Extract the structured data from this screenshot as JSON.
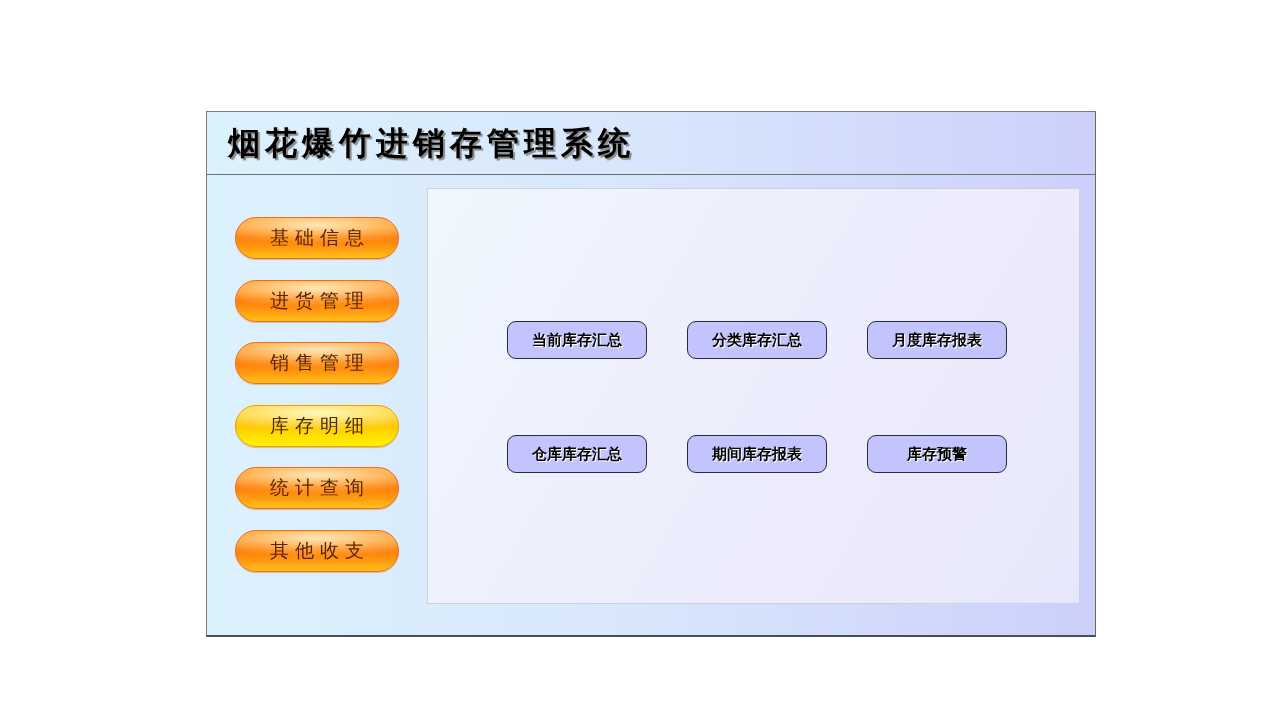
{
  "title": "烟花爆竹进销存管理系统",
  "sidebar": {
    "items": [
      {
        "label": "基础信息",
        "selected": false
      },
      {
        "label": "进货管理",
        "selected": false
      },
      {
        "label": "销售管理",
        "selected": false
      },
      {
        "label": "库存明细",
        "selected": true
      },
      {
        "label": "统计查询",
        "selected": false
      },
      {
        "label": "其他收支",
        "selected": false
      }
    ]
  },
  "panel": {
    "buttons": [
      {
        "label": "当前库存汇总"
      },
      {
        "label": "分类库存汇总"
      },
      {
        "label": "月度库存报表"
      },
      {
        "label": "仓库库存汇总"
      },
      {
        "label": "期间库存报表"
      },
      {
        "label": "库存预警"
      }
    ]
  }
}
